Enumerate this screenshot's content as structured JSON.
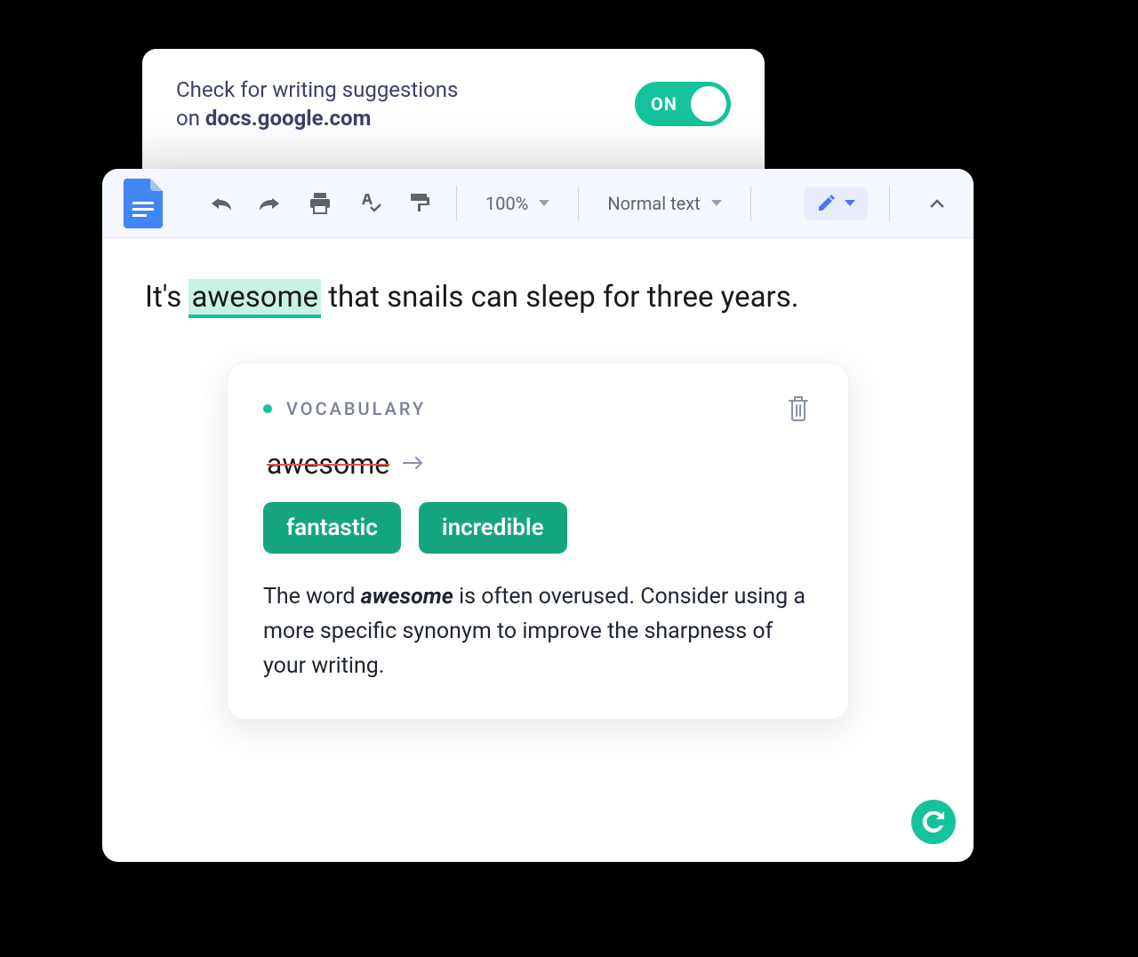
{
  "toggleCard": {
    "textPrefix": "Check for writing suggestions",
    "textPrefix2": "on ",
    "domain": "docs.google.com",
    "state": "ON"
  },
  "toolbar": {
    "zoom": "100%",
    "style": "Normal text"
  },
  "document": {
    "prefix": "It's ",
    "highlighted": "awesome",
    "suffix": " that snails can sleep for three years."
  },
  "suggestion": {
    "category": "VOCABULARY",
    "original": "awesome",
    "alt1": "fantastic",
    "alt2": "incredible",
    "exp1": "The word ",
    "expEm": "awesome",
    "exp2": " is often overused. Consider using a more specific synonym to improve the sharpness of your writing."
  }
}
